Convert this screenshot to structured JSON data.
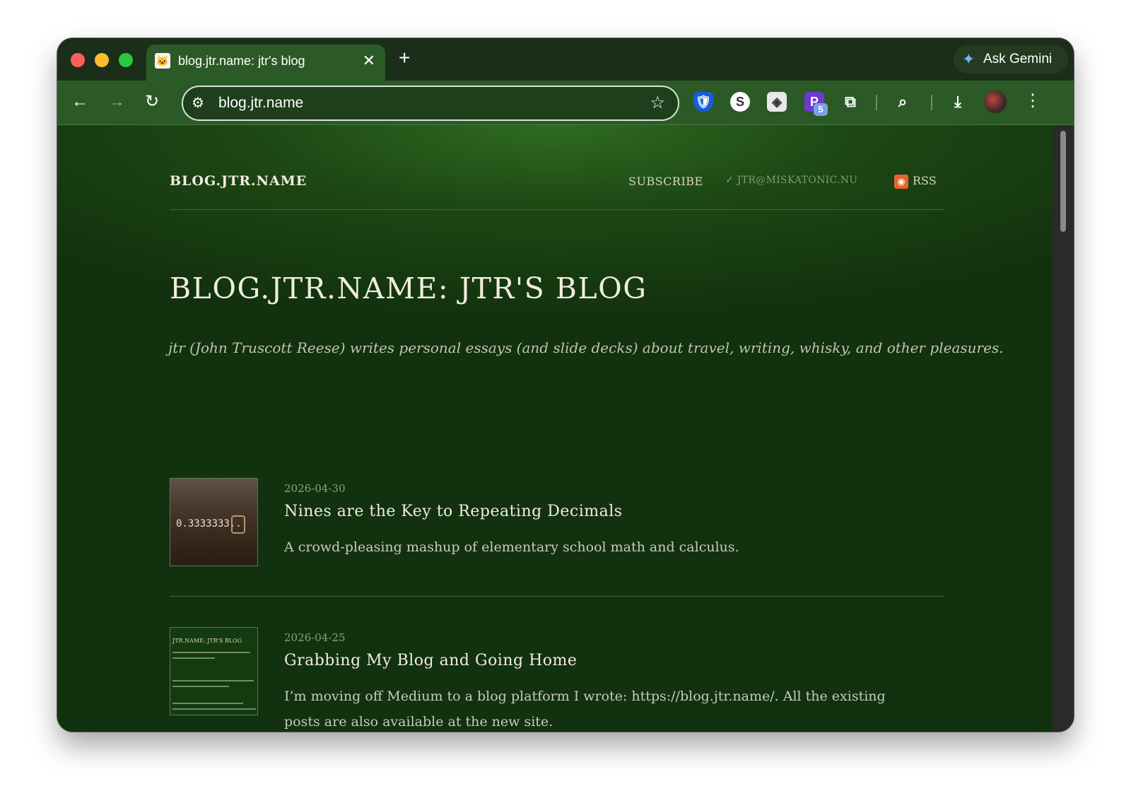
{
  "browser": {
    "tab": {
      "title": "blog.jtr.name: jtr's blog",
      "close": "✕",
      "favicon": "🐱"
    },
    "new_tab": "+",
    "ask_gemini": "Ask Gemini",
    "address": "blog.jtr.name",
    "extensions": [
      {
        "name": "bitwarden-icon",
        "glyph": "🛡"
      },
      {
        "name": "s-extension-icon",
        "glyph": "S"
      },
      {
        "name": "photo-extension-icon",
        "glyph": "◈"
      },
      {
        "name": "p-extension-icon",
        "glyph": "P",
        "badge": "5"
      },
      {
        "name": "puzzle-icon",
        "glyph": "⧉"
      }
    ]
  },
  "site": {
    "name": "BLOG.JTR.NAME",
    "nav": {
      "subscribe": "SUBSCRIBE",
      "email": "✓ JTR@MISKATONIC.NU",
      "rss": "RSS"
    },
    "title": "BLOG.JTR.NAME: JTR'S BLOG",
    "tagline": "jtr (John Truscott Reese) writes personal essays (and slide decks) about travel, writing, whisky, and other pleasures."
  },
  "posts": [
    {
      "date": "2026-04-30",
      "title": "Nines are the Key to Repeating Decimals",
      "excerpt": "A crowd-pleasing mashup of elementary school math and calculus.",
      "thumb_text": "0.3333333..."
    },
    {
      "date": "2026-04-25",
      "title": "Grabbing My Blog and Going Home",
      "excerpt": "I’m moving off Medium to a blog platform I wrote: https://blog.jtr.name/. All the existing posts are also available at the new site.",
      "thumb_text": "JTR.NAME: JTR'S BLOG"
    }
  ],
  "colors": {
    "accent": "#2c5a27",
    "page_bg": "#12310e",
    "rss": "#e8632d"
  }
}
